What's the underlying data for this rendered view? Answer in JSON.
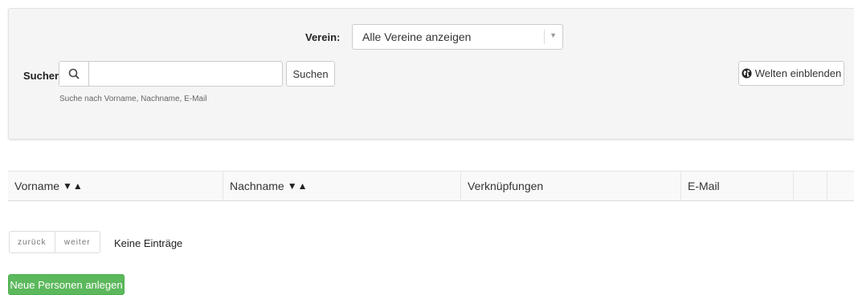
{
  "filter": {
    "verein_label": "Verein:",
    "verein_value": "Alle Vereine anzeigen",
    "search_label": "Suchen",
    "search_placeholder": "",
    "search_button": "Suchen",
    "search_hint": "Suche nach Vorname, Nachname, E-Mail",
    "worlds_button": "Welten einblenden"
  },
  "table": {
    "columns": [
      {
        "label": "Vorname",
        "sortable": true
      },
      {
        "label": "Nachname",
        "sortable": true
      },
      {
        "label": "Verknüpfungen",
        "sortable": false
      },
      {
        "label": "E-Mail",
        "sortable": false
      }
    ],
    "sort_arrows": "▼▲"
  },
  "pagination": {
    "prev": "zurück",
    "next": "weiter",
    "empty_text": "Keine Einträge"
  },
  "actions": {
    "new_persons": "Neue Personen anlegen"
  },
  "icons": {
    "search": "search-icon",
    "globe": "globe-icon",
    "dropdown": "caret-down-icon"
  },
  "colors": {
    "panel_bg": "#f5f5f5",
    "success": "#5cb85c"
  }
}
